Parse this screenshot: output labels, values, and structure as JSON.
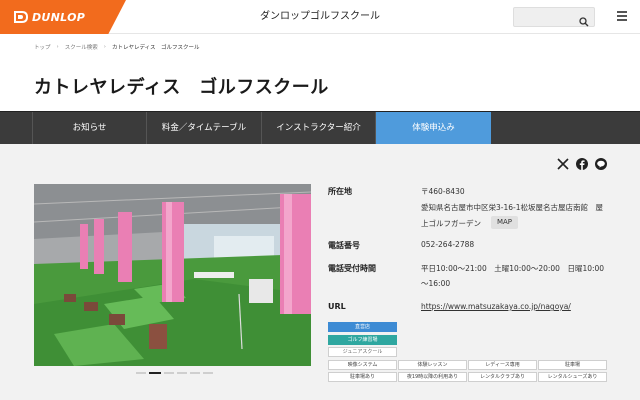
{
  "header": {
    "brand": "DUNLOP",
    "site_title": "ダンロップゴルフスクール",
    "search_placeholder": ""
  },
  "breadcrumb": [
    "トップ",
    "スクール検索",
    "カトレヤレディス　ゴルフスクール"
  ],
  "page_title": "カトレヤレディス　ゴルフスクール",
  "nav": [
    "お知らせ",
    "料金／タイムテーブル",
    "インストラクター紹介",
    "体験申込み"
  ],
  "info": {
    "address_label": "所在地",
    "postal": "〒460-8430",
    "address_line1": "愛知県名古屋市中区栄3-16-1松坂屋名古屋店南館　屋",
    "address_line2": "上ゴルフガーデン",
    "map_label": "MAP",
    "phone_label": "電話番号",
    "phone": "052-264-2788",
    "hours_label": "電話受付時間",
    "hours_line1": "平日10:00～21:00　土曜10:00～20:00　日曜10:00",
    "hours_line2": "～16:00",
    "url_label": "URL",
    "url": "https://www.matsuzakaya.co.jp/nagoya/"
  },
  "badges": [
    "直営店",
    "ゴルフ練習場",
    "ジュニアスクール"
  ],
  "tags": [
    [
      "映像システム",
      "体験レッスン",
      "レディース専用",
      "駐車場"
    ],
    [
      "駐車場あり",
      "夜19時以降の利用あり",
      "レンタルクラブあり",
      "レンタルシューズあり"
    ]
  ],
  "colors": {
    "brand_orange": "#f26b1d",
    "nav_bg": "#3b3b3b",
    "nav_active": "#4f9bdc",
    "badge_blue": "#3d8bd4",
    "badge_teal": "#2fa7a0"
  },
  "icons": [
    "search-icon",
    "menu-icon",
    "x-icon",
    "facebook-icon",
    "line-icon"
  ]
}
